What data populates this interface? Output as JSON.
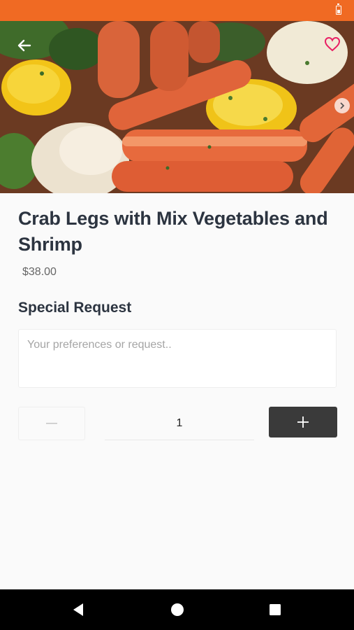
{
  "status_bar": {
    "color": "#f06a23",
    "icons": [
      "battery-icon"
    ]
  },
  "hero": {
    "icons": {
      "back": "arrow-left-icon",
      "favorite": "heart-outline-icon",
      "next": "chevron-right-icon"
    },
    "heart_color": "#e91e63"
  },
  "item": {
    "title": "Crab Legs with Mix Vegetables and Shrimp",
    "price": "$38.00"
  },
  "special_request": {
    "label": "Special Request",
    "placeholder": "Your preferences or request..",
    "value": ""
  },
  "quantity": {
    "value": "1",
    "decrement_icon": "minus-icon",
    "increment_icon": "plus-icon",
    "increment_bg": "#3a3a3a"
  },
  "nav_bar": {
    "icons": [
      "back-triangle-icon",
      "home-circle-icon",
      "recents-square-icon"
    ]
  }
}
